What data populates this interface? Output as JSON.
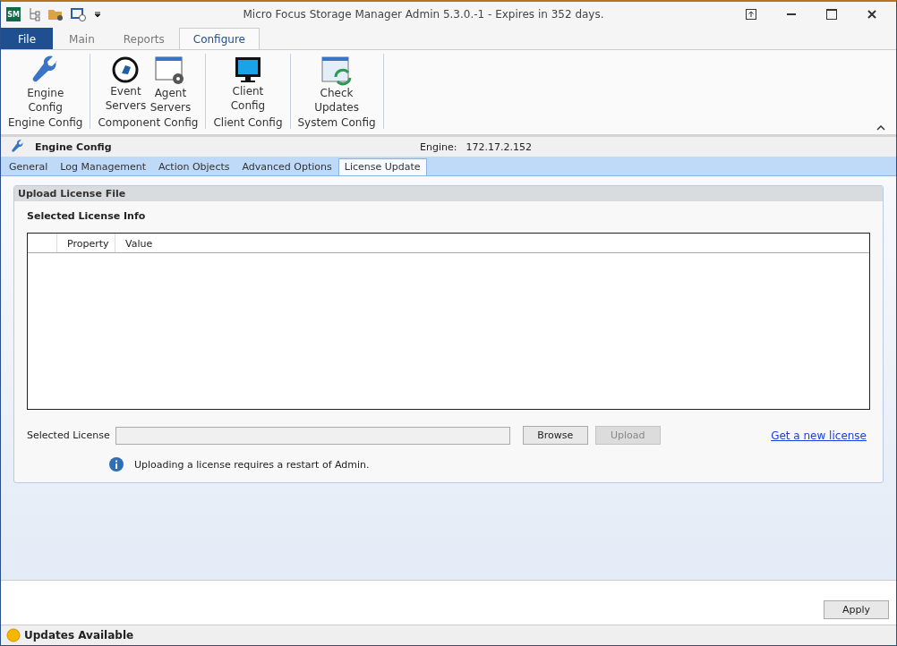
{
  "window": {
    "title": "Micro Focus Storage Manager Admin 5.3.0.-1 - Expires in 352 days.",
    "app_badge": "SM"
  },
  "menu_tabs": [
    {
      "label": "File",
      "kind": "file",
      "selected": false
    },
    {
      "label": "Main",
      "kind": "tab",
      "selected": false
    },
    {
      "label": "Reports",
      "kind": "tab",
      "selected": false
    },
    {
      "label": "Configure",
      "kind": "tab",
      "selected": true
    }
  ],
  "ribbon_groups": [
    {
      "label": "Engine Config",
      "buttons": [
        {
          "kind": "wrench",
          "label": "Engine\nConfig"
        }
      ]
    },
    {
      "label": "Component Config",
      "buttons": [
        {
          "kind": "event",
          "label": "Event\nServers"
        },
        {
          "kind": "agent",
          "label": "Agent\nServers"
        }
      ]
    },
    {
      "label": "Client Config",
      "buttons": [
        {
          "kind": "monitor",
          "label": "Client\nConfig"
        }
      ]
    },
    {
      "label": "System Config",
      "buttons": [
        {
          "kind": "update",
          "label": "Check\nUpdates"
        }
      ]
    }
  ],
  "section": {
    "title": "Engine Config",
    "engine_label": "Engine:",
    "engine_value": "172.17.2.152"
  },
  "sub_tabs": [
    {
      "label": "General",
      "selected": false
    },
    {
      "label": "Log Management",
      "selected": false
    },
    {
      "label": "Action Objects",
      "selected": false
    },
    {
      "label": "Advanced Options",
      "selected": false
    },
    {
      "label": "License Update",
      "selected": true
    }
  ],
  "panel": {
    "title": "Upload License File",
    "subtitle": "Selected License Info",
    "table": {
      "columns": [
        "Property",
        "Value"
      ]
    },
    "file_label": "Selected License",
    "buttons": [
      {
        "label": "Browse",
        "disabled": false
      },
      {
        "label": "Upload",
        "disabled": true
      }
    ],
    "link": "Get a new license",
    "info": "Uploading a license requires a restart of Admin."
  },
  "apply_button": "Apply",
  "status_bar": "Updates Available"
}
